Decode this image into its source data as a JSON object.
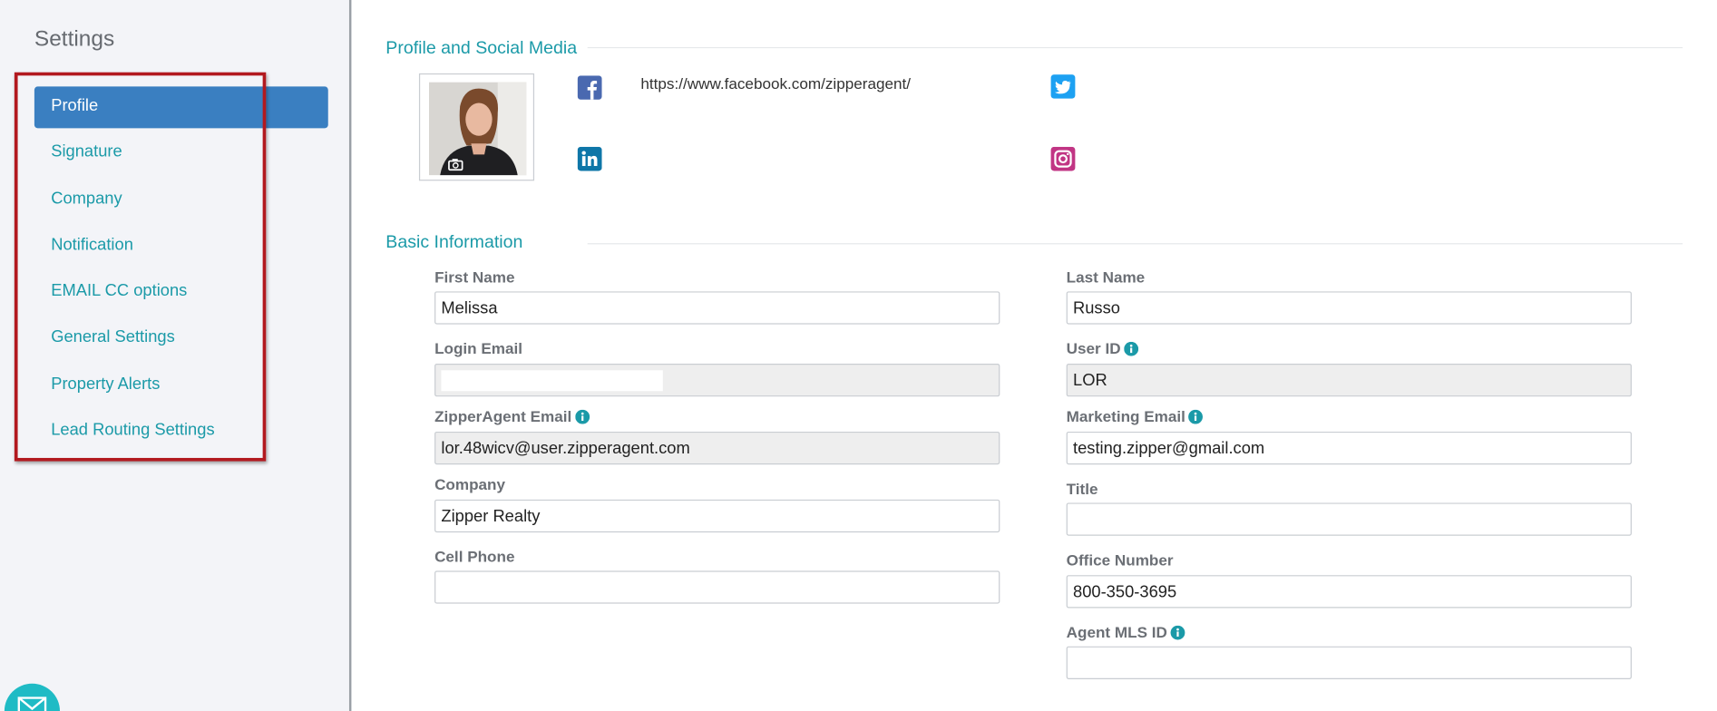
{
  "sidebar": {
    "title": "Settings",
    "items": [
      {
        "label": "Profile",
        "active": true
      },
      {
        "label": "Signature"
      },
      {
        "label": "Company"
      },
      {
        "label": "Notification"
      },
      {
        "label": "EMAIL CC options"
      },
      {
        "label": "General Settings"
      },
      {
        "label": "Property Alerts"
      },
      {
        "label": "Lead Routing Settings"
      }
    ],
    "chat_icon": "mail-icon"
  },
  "profile_section": {
    "title": "Profile and Social Media",
    "facebook_url": "https://www.facebook.com/zipperagent/",
    "icons": [
      "camera-icon",
      "facebook-icon",
      "twitter-icon",
      "linkedin-icon",
      "instagram-icon"
    ]
  },
  "basic_info": {
    "title": "Basic Information",
    "first_name": {
      "label": "First Name",
      "value": "Melissa"
    },
    "last_name": {
      "label": "Last Name",
      "value": "Russo"
    },
    "login_email": {
      "label": "Login Email",
      "value": ""
    },
    "user_id": {
      "label": "User ID",
      "value": "LOR"
    },
    "zipperagent_email": {
      "label": "ZipperAgent Email",
      "value": "lor.48wicv@user.zipperagent.com"
    },
    "marketing_email": {
      "label": "Marketing Email",
      "value": "testing.zipper@gmail.com"
    },
    "company": {
      "label": "Company",
      "value": "Zipper Realty"
    },
    "title_field": {
      "label": "Title",
      "value": ""
    },
    "cell_phone": {
      "label": "Cell Phone",
      "value": ""
    },
    "office_number": {
      "label": "Office Number",
      "value": "800-350-3695"
    },
    "agent_mls_id": {
      "label": "Agent MLS ID",
      "value": ""
    }
  },
  "colors": {
    "accent": "#1b9aa8",
    "active_nav": "#3a7fc1",
    "highlight_border": "#b2191f",
    "facebook": "#4a69b0",
    "twitter": "#1da1f2",
    "linkedin": "#0e76a8",
    "instagram": "#c13584"
  }
}
